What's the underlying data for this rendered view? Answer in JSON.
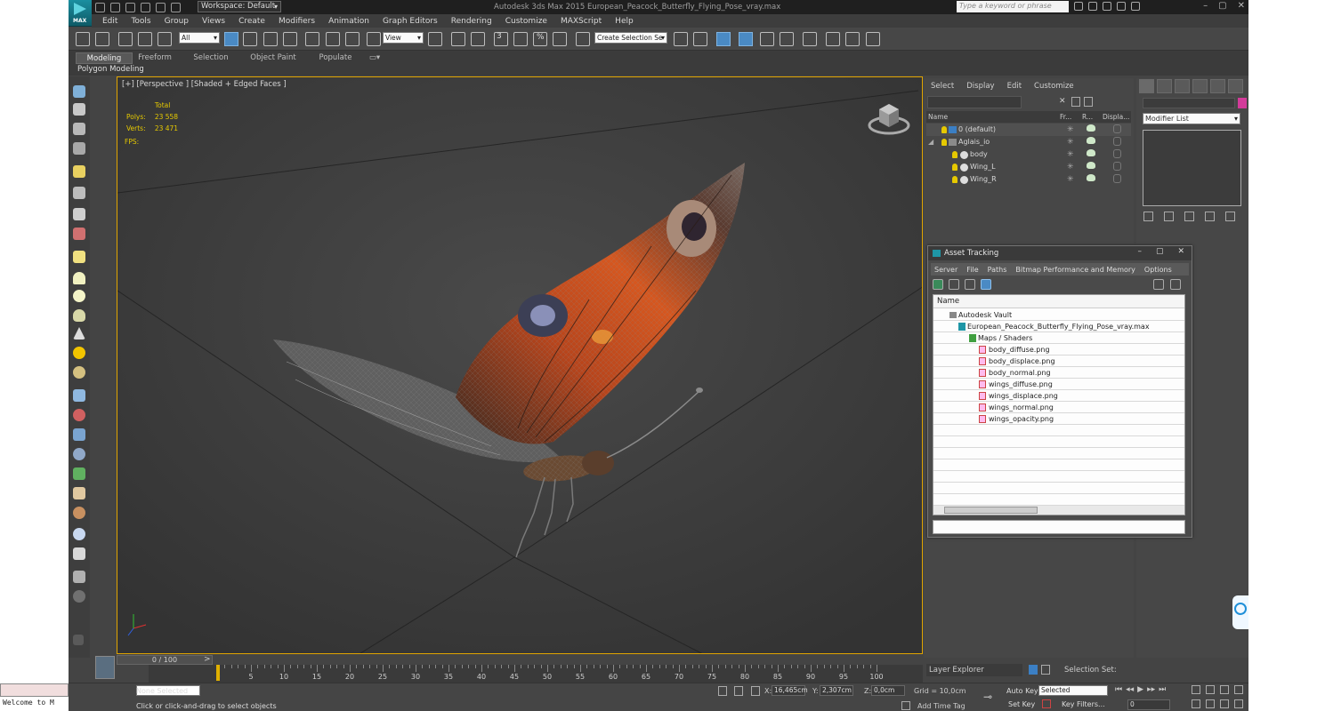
{
  "window": {
    "app_title": "Autodesk 3ds Max 2015    European_Peacock_Butterfly_Flying_Pose_vray.max",
    "logo_text": "MAX",
    "workspace_label": "Workspace: Default",
    "search_placeholder": "Type a keyword or phrase"
  },
  "menubar": {
    "items": [
      "Edit",
      "Tools",
      "Group",
      "Views",
      "Create",
      "Modifiers",
      "Animation",
      "Graph Editors",
      "Rendering",
      "Customize",
      "MAXScript",
      "Help"
    ]
  },
  "toolbar": {
    "selection_filter": "All",
    "reference_coord": "View",
    "named_selection_placeholder": "Create Selection Se",
    "snap_labels": [
      "3",
      "%"
    ]
  },
  "ribbon": {
    "tabs": [
      "Modeling",
      "Freeform",
      "Selection",
      "Object Paint",
      "Populate"
    ],
    "active_tab": "Modeling",
    "panel_label": "Polygon Modeling"
  },
  "viewport": {
    "label": "[+] [Perspective ] [Shaded + Edged Faces ]",
    "stats_header": "Total",
    "polys_label": "Polys:",
    "polys_value": "23 558",
    "verts_label": "Verts:",
    "verts_value": "23 471",
    "fps_label": "FPS:"
  },
  "timeline": {
    "frame_display": "0 / 100",
    "ticks": [
      "0",
      "5",
      "10",
      "15",
      "20",
      "25",
      "30",
      "35",
      "40",
      "45",
      "50",
      "55",
      "60",
      "65",
      "70",
      "75",
      "80",
      "85",
      "90",
      "95",
      "100"
    ]
  },
  "scene_explorer": {
    "menu": [
      "Select",
      "Display",
      "Edit",
      "Customize"
    ],
    "columns": [
      "Name",
      "Fr...",
      "R...",
      "Displa..."
    ],
    "rows": [
      {
        "name": "0 (default)"
      },
      {
        "name": "Aglais_io"
      },
      {
        "name": "body"
      },
      {
        "name": "Wing_L"
      },
      {
        "name": "Wing_R"
      }
    ],
    "bottom_label": "Layer Explorer",
    "selection_set_label": "Selection Set:"
  },
  "command_panel": {
    "modifier_list": "Modifier List",
    "accent_color": "#d33b9a"
  },
  "asset_tracking": {
    "title": "Asset Tracking",
    "menu": [
      "Server",
      "File",
      "Paths",
      "Bitmap Performance and Memory",
      "Options"
    ],
    "header": "Name",
    "rows": [
      {
        "label": "Autodesk Vault"
      },
      {
        "label": "European_Peacock_Butterfly_Flying_Pose_vray.max"
      },
      {
        "label": "Maps / Shaders"
      },
      {
        "label": "body_diffuse.png"
      },
      {
        "label": "body_displace.png"
      },
      {
        "label": "body_normal.png"
      },
      {
        "label": "wings_diffuse.png"
      },
      {
        "label": "wings_displace.png"
      },
      {
        "label": "wings_normal.png"
      },
      {
        "label": "wings_opacity.png"
      }
    ]
  },
  "statusbar": {
    "maxscript_text": "Welcome to M",
    "selection_status": "None Selected",
    "prompt": "Click or click-and-drag to select objects",
    "x_label": "X:",
    "x_value": "16,465cm",
    "y_label": "Y:",
    "y_value": "2,307cm",
    "z_label": "Z:",
    "z_value": "0,0cm",
    "grid": "Grid = 10,0cm",
    "add_time_tag": "Add Time Tag",
    "auto_key": "Auto Key",
    "set_key": "Set Key",
    "selected_dropdown": "Selected",
    "key_filters": "Key Filters...",
    "frame_value": "0"
  }
}
